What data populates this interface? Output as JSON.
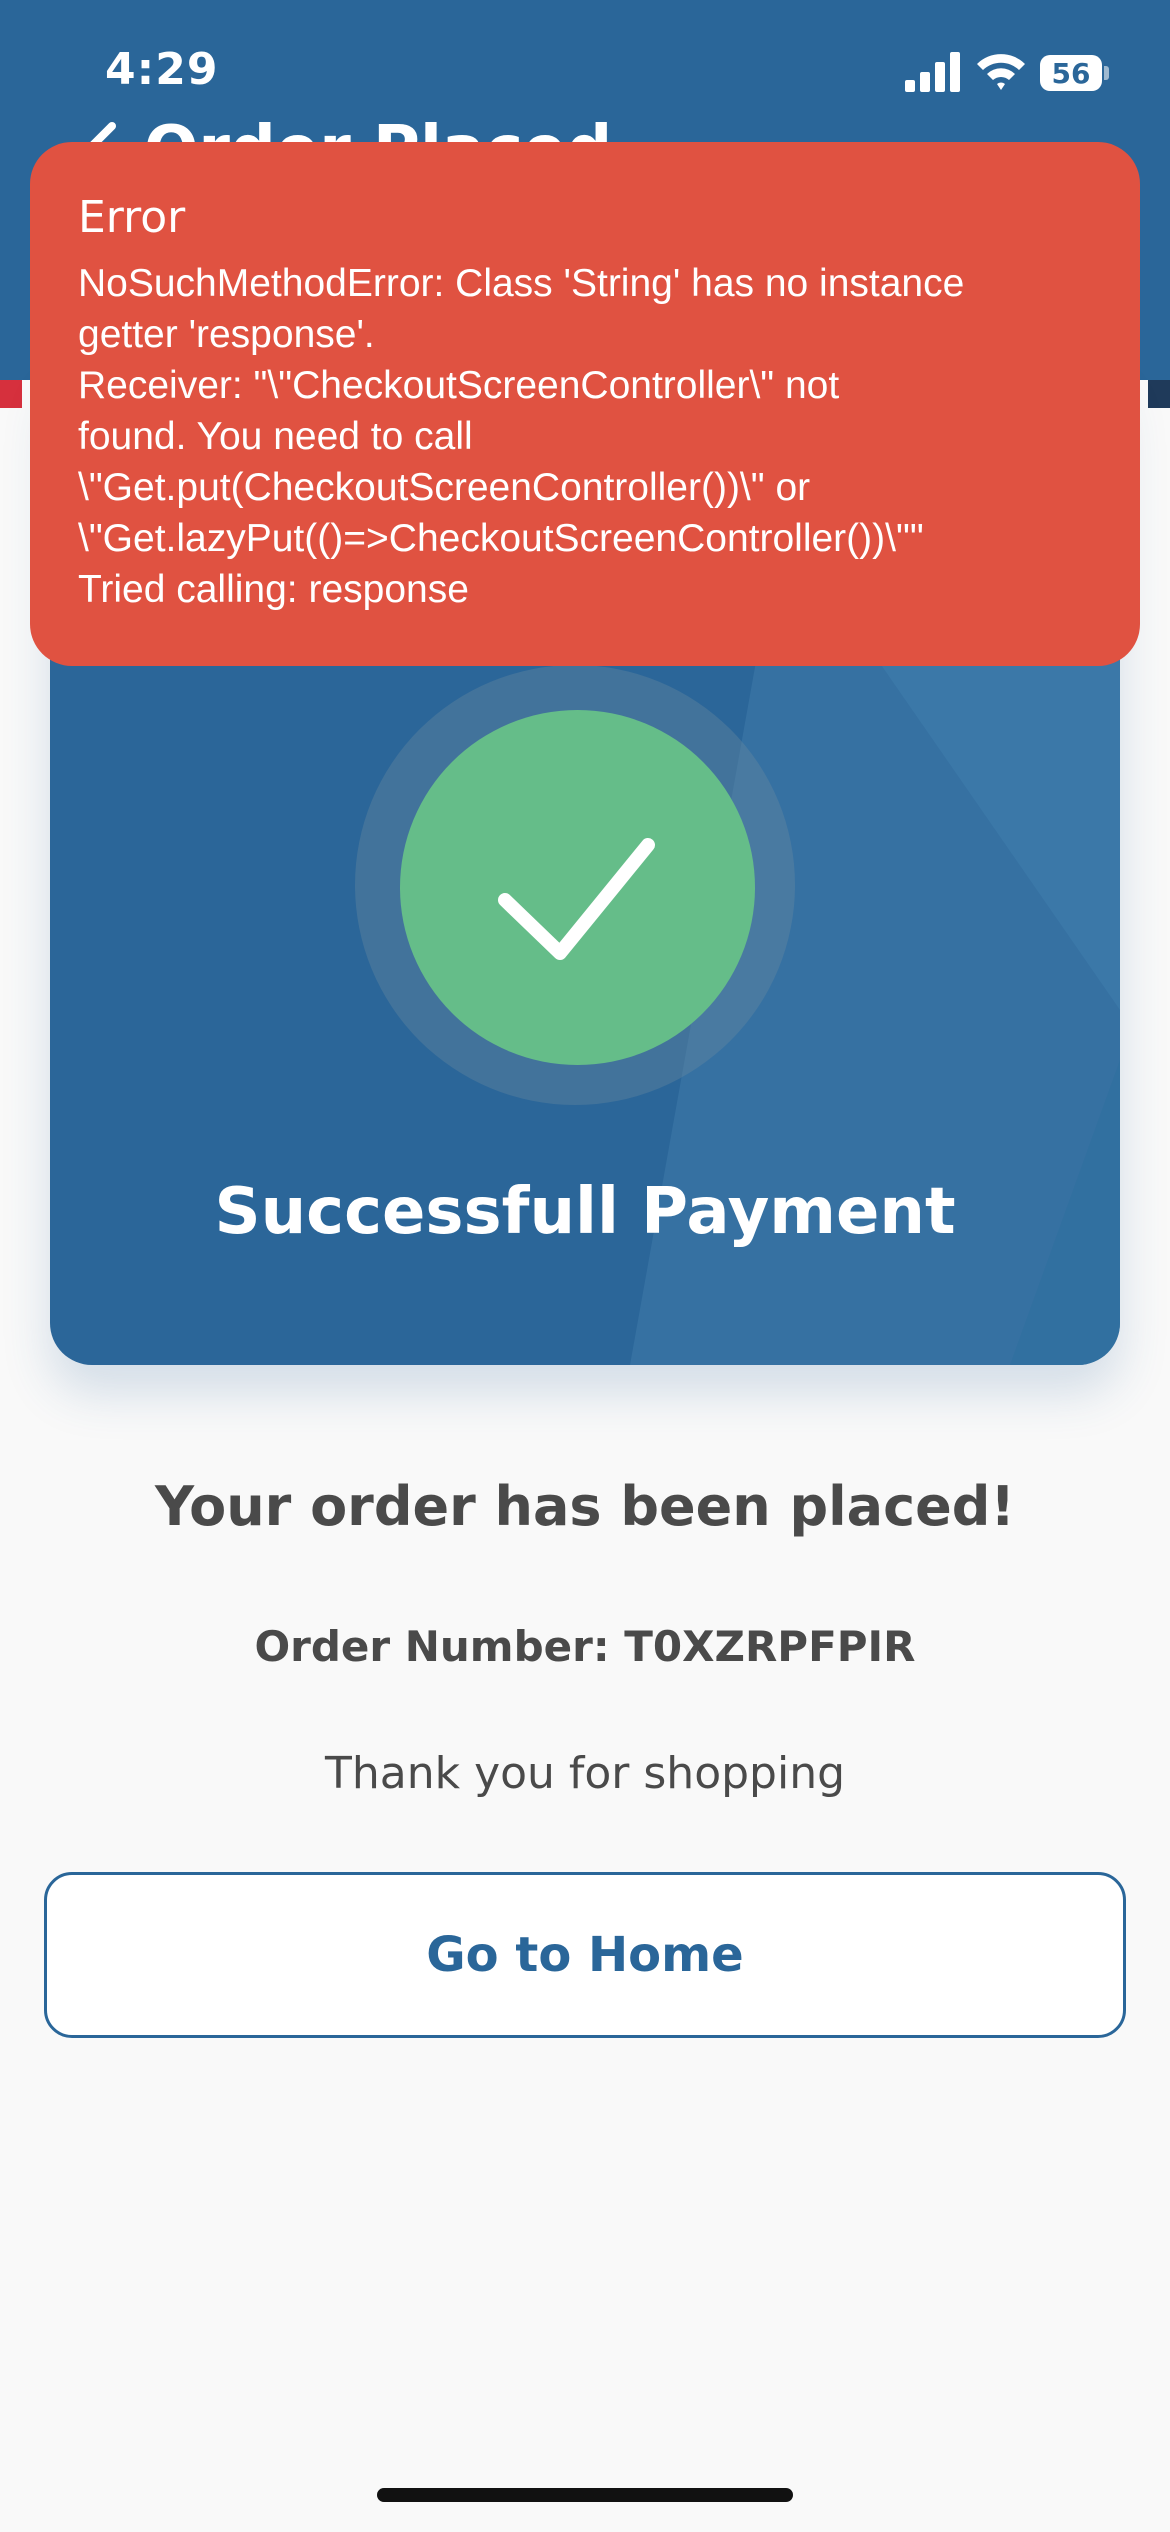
{
  "status_bar": {
    "time": "4:29",
    "battery_level": "56",
    "icons": [
      "signal-icon",
      "wifi-icon",
      "battery-icon"
    ]
  },
  "nav": {
    "title": "Order Placed",
    "back_icon": "chevron-left-icon"
  },
  "card": {
    "title": "Successfull Payment",
    "icon": "checkmark-icon"
  },
  "order": {
    "headline": "Your order has been placed!",
    "number_text": "Order Number: T0XZRPFPIR",
    "thanks": "Thank you for shopping"
  },
  "buttons": {
    "home_label": "Go to Home"
  },
  "error": {
    "title": "Error",
    "message": "NoSuchMethodError: Class 'String' has no instance\ngetter 'response'.\nReceiver: \"\\\"CheckoutScreenController\\\" not\nfound. You need to call\n\\\"Get.put(CheckoutScreenController())\\\" or\n\\\"Get.lazyPut(()=>CheckoutScreenController())\\\"\"\nTried calling: response"
  },
  "colors": {
    "header": "#2a6699",
    "card": "#2b6699",
    "success": "#65bd89",
    "error": "#e05241",
    "text": "#4a4a4a",
    "background": "#f9f9f9"
  }
}
